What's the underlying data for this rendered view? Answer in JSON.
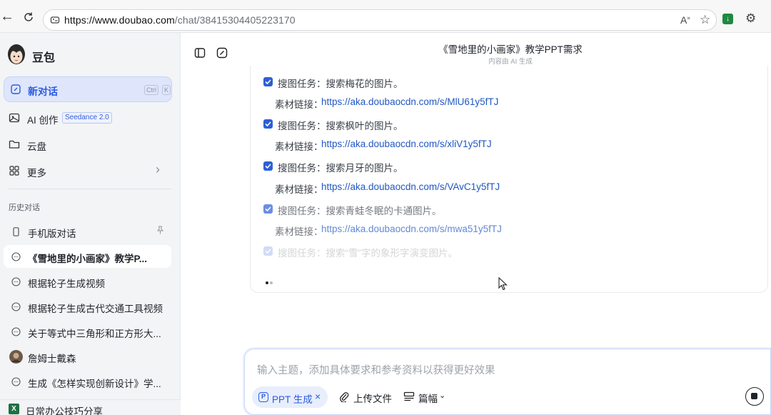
{
  "browser": {
    "url_host": "https://www.doubao.com",
    "url_path": "/chat/38415304405223170"
  },
  "sidebar": {
    "brand": "豆包",
    "new_chat": "新对话",
    "shortcut_ctrl": "Ctrl",
    "shortcut_key": "K",
    "ai_create": "AI 创作",
    "ai_badge": "Seedance 2.0",
    "cloud": "云盘",
    "more": "更多",
    "history_title": "历史对话",
    "history": [
      "手机版对话",
      "《雪地里的小画家》教学P...",
      "根据轮子生成视频",
      "根据轮子生成古代交通工具视频",
      "关于等式中三角形和正方形大...",
      "詹姆士戴森",
      "生成《怎样实现创新设计》学..."
    ],
    "bottom_item": "日常办公技巧分享"
  },
  "chat": {
    "title": "《雪地里的小画家》教学PPT需求",
    "subtitle": "内容由 AI 生成",
    "link_label": "素材链接：",
    "tasks": [
      {
        "text": "搜图任务：搜索梅花的图片。",
        "link": "https://aka.doubaocdn.com/s/MlU61y5fTJ"
      },
      {
        "text": "搜图任务：搜索枫叶的图片。",
        "link": "https://aka.doubaocdn.com/s/xliV1y5fTJ"
      },
      {
        "text": "搜图任务：搜索月牙的图片。",
        "link": "https://aka.doubaocdn.com/s/VAvC1y5fTJ"
      },
      {
        "text": "搜图任务：搜索青蛙冬眠的卡通图片。",
        "link": "https://aka.doubaocdn.com/s/mwa51y5fTJ"
      },
      {
        "text": "搜图任务：搜索“雪”字的象形字演变图片。"
      }
    ]
  },
  "input": {
    "placeholder": "输入主题，添加具体要求和参考资料以获得更好效果",
    "chip_label": "PPT 生成",
    "upload": "上传文件",
    "length": "篇幅"
  },
  "colors": {
    "accent": "#2d5be0",
    "link": "#2157c2",
    "sidebar_bg": "#f3f4f6"
  }
}
